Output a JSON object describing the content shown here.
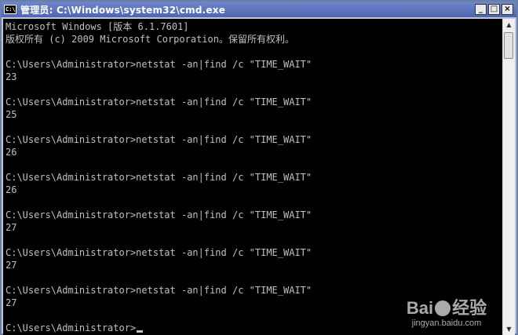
{
  "window": {
    "title": "管理员: C:\\Windows\\system32\\cmd.exe",
    "icon": "cmd-console-icon",
    "icon_glyph": "C:\\",
    "buttons": {
      "minimize": "_",
      "maximize": "□",
      "close": "×"
    }
  },
  "console": {
    "background": "#000000",
    "foreground": "#c0c0c0",
    "lines": [
      "Microsoft Windows [版本 6.1.7601]",
      "版权所有 (c) 2009 Microsoft Corporation。保留所有权利。",
      "",
      "C:\\Users\\Administrator>netstat -an|find /c \"TIME_WAIT\"",
      "23",
      "",
      "C:\\Users\\Administrator>netstat -an|find /c \"TIME_WAIT\"",
      "25",
      "",
      "C:\\Users\\Administrator>netstat -an|find /c \"TIME_WAIT\"",
      "26",
      "",
      "C:\\Users\\Administrator>netstat -an|find /c \"TIME_WAIT\"",
      "26",
      "",
      "C:\\Users\\Administrator>netstat -an|find /c \"TIME_WAIT\"",
      "27",
      "",
      "C:\\Users\\Administrator>netstat -an|find /c \"TIME_WAIT\"",
      "27",
      "",
      "C:\\Users\\Administrator>netstat -an|find /c \"TIME_WAIT\"",
      "27",
      "",
      "C:\\Users\\Administrator>"
    ]
  },
  "scrollbar": {
    "up_arrow": "▲",
    "down_arrow": "▼"
  },
  "watermark": {
    "logo": "Bai",
    "logo_suffix": "经验",
    "url": "jingyan.baidu.com"
  }
}
